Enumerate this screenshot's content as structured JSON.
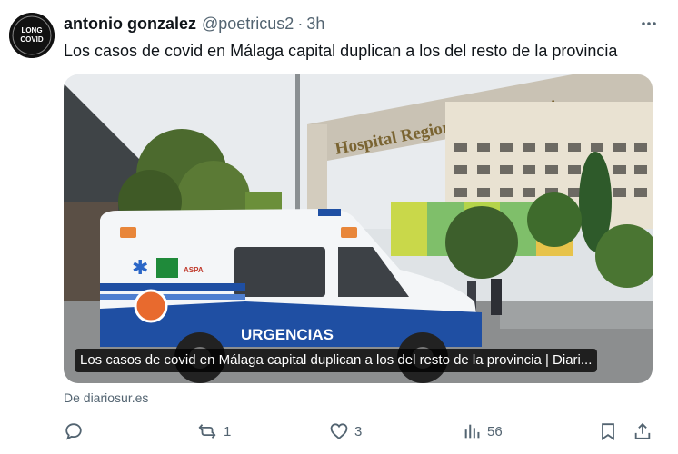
{
  "avatar": {
    "lines": [
      "LONG",
      "COVID"
    ]
  },
  "post": {
    "author_name": "antonio gonzalez",
    "handle": "@poetricus2",
    "separator": "·",
    "time": "3h",
    "text": "Los casos de covid en Málaga capital duplican a los del resto de la provincia"
  },
  "card": {
    "image_caption": "Los casos de covid en Málaga capital duplican a los del resto de la provincia | Diari...",
    "hospital_sign": "Hospital Regional Universitario",
    "ambulance_label": "URGENCIAS",
    "ambulance_text": "ASPA",
    "source": "De diariosur.es"
  },
  "actions": {
    "replies": "",
    "reposts": "1",
    "likes": "3",
    "views": "56"
  },
  "colors": {
    "text": "#0f1419",
    "secondary": "#536471",
    "ambulance_blue": "#1f4fa3"
  }
}
